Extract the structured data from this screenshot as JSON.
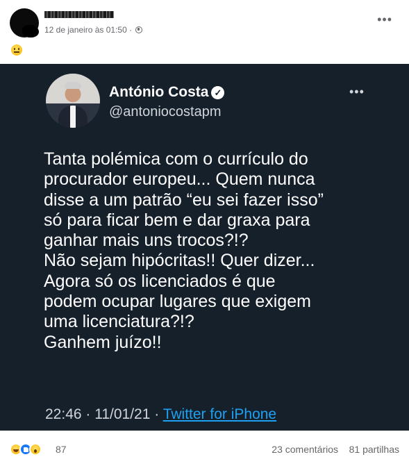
{
  "post": {
    "timestamp": "12 de janeiro às 01:50",
    "meta_separator": "·",
    "privacy_icon": "globe-icon",
    "more_icon": "ellipsis-icon",
    "text_emoji": "neutral-face-emoji"
  },
  "tweet": {
    "name": "António Costa",
    "verified_icon": "verified-check-icon",
    "handle": "@antoniocostapm",
    "more_icon": "ellipsis-icon",
    "body_lines": [
      "Tanta polémica com o currículo do",
      "procurador europeu... Quem nunca",
      "disse a um patrão “eu sei fazer isso”",
      "só para ficar bem e dar graxa para",
      "ganhar mais uns trocos?!?",
      "Não sejam hipócritas!! Quer dizer...",
      "Agora só os licenciados é que",
      "podem ocupar lugares que exigem",
      "uma licenciatura?!?",
      "Ganhem juízo!!"
    ],
    "time": "22:46 · 11/01/21 ·",
    "source": "Twitter for iPhone"
  },
  "stats": {
    "reaction_icons": [
      "haha-icon",
      "like-icon",
      "wow-icon"
    ],
    "reaction_count": "87",
    "comments": "23 comentários",
    "shares": "81 partilhas"
  },
  "colors": {
    "tweet_bg": "#15202b",
    "link": "#1da1f2",
    "meta_text": "#65676b"
  }
}
